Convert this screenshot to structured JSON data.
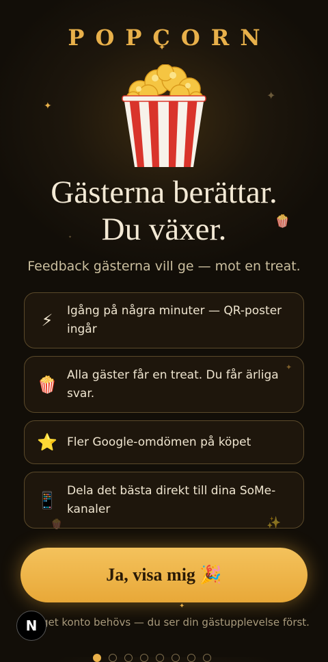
{
  "brand": "POPCORN",
  "hero_icon": "popcorn-bucket-icon",
  "headline": {
    "line1": "Gästerna berättar.",
    "line2": "Du växer."
  },
  "subtitle": "Feedback gästerna vill ge — mot en treat.",
  "features": [
    {
      "icon": "⚡",
      "icon_name": "lightning-icon",
      "text": "Igång på några minuter — QR-poster ingår"
    },
    {
      "icon": "🍿",
      "icon_name": "popcorn-icon",
      "text": "Alla gäster får en treat. Du får ärliga svar."
    },
    {
      "icon": "⭐",
      "icon_name": "star-icon",
      "text": "Fler Google-omdömen på köpet"
    },
    {
      "icon": "📱",
      "icon_name": "phone-icon",
      "text": "Dela det bästa direkt till dina SoMe-kanaler"
    }
  ],
  "cta": {
    "label": "Ja, visa mig 🎉"
  },
  "note": "Inget konto behövs — du ser din gästupplevelse först.",
  "badge": "N",
  "pagination": {
    "total": 8,
    "current": 1
  },
  "colors": {
    "accent": "#e8b04a",
    "background": "#1d160c",
    "button": "#f2bb52",
    "text": "#f3e9d5"
  }
}
